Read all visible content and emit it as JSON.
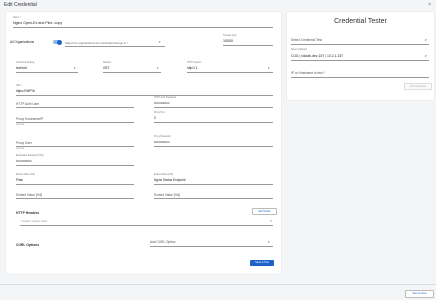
{
  "dialog": {
    "title": "Edit Credential",
    "close_icon": "×"
  },
  "form": {
    "name": {
      "label": "Name *",
      "value": "Nginx Open-Ex and Plex- copy"
    },
    "all_orgs": {
      "label": "All Organizations"
    },
    "org_select": {
      "placeholder": "Select the organizations the credential belongs to *"
    },
    "timeout": {
      "label": "Timeout (ms)",
      "value": "10000"
    },
    "content_encoding": {
      "label": "Content Encoding",
      "value": "text/xml"
    },
    "method": {
      "label": "Method",
      "value": "GET"
    },
    "http_version": {
      "label": "HTTP Version",
      "value": "http/1.1"
    },
    "url": {
      "label": "URL *",
      "value": "https://%IP%/"
    },
    "http_auth_user": {
      "label": "HTTP Auth User"
    },
    "http_auth_password": {
      "label": "HTTP Auth Password",
      "value": "••••••••••••••"
    },
    "proxy_host": {
      "label": "Proxy Hostname/IP",
      "helper": "optional"
    },
    "proxy_port": {
      "label": "Proxy Port",
      "value": "0"
    },
    "proxy_user": {
      "label": "Proxy User",
      "helper": "optional"
    },
    "proxy_password": {
      "label": "Proxy Password",
      "value": "••••••••••••••"
    },
    "embedded_password": {
      "label": "Embedded Password (%P)",
      "value": "••••••••••••••"
    },
    "embed_value_1": {
      "label": "Embed Value [%1]",
      "value": "Plain"
    },
    "embed_value_2": {
      "label": "Embed Value [%2]",
      "value": "Nginx Status Endpoint"
    },
    "embed_value_3": {
      "label": "Embed Value [%3]"
    },
    "embed_value_4": {
      "label": "Embed Value [%4]"
    },
    "http_headers": {
      "title": "HTTP Headers",
      "add_label": "Add Header",
      "placeholder": "* Header: Header Value",
      "delete_icon": "×"
    },
    "curl_options": {
      "title": "CURL Options",
      "placeholder": "Add CURL Option"
    },
    "save_label": "Save & Test"
  },
  "tester": {
    "title": "Credential Tester",
    "select_test": {
      "placeholder": "Select Credential Test"
    },
    "collector": {
      "label": "Select Collector",
      "value": "CUG | silolab-dev-157 | 10.2.1.157"
    },
    "ip_host": {
      "placeholder": "IP or Hostname to test *"
    },
    "run_label": "Test Credential"
  },
  "footer": {
    "save_close_label": "Save & Close"
  }
}
